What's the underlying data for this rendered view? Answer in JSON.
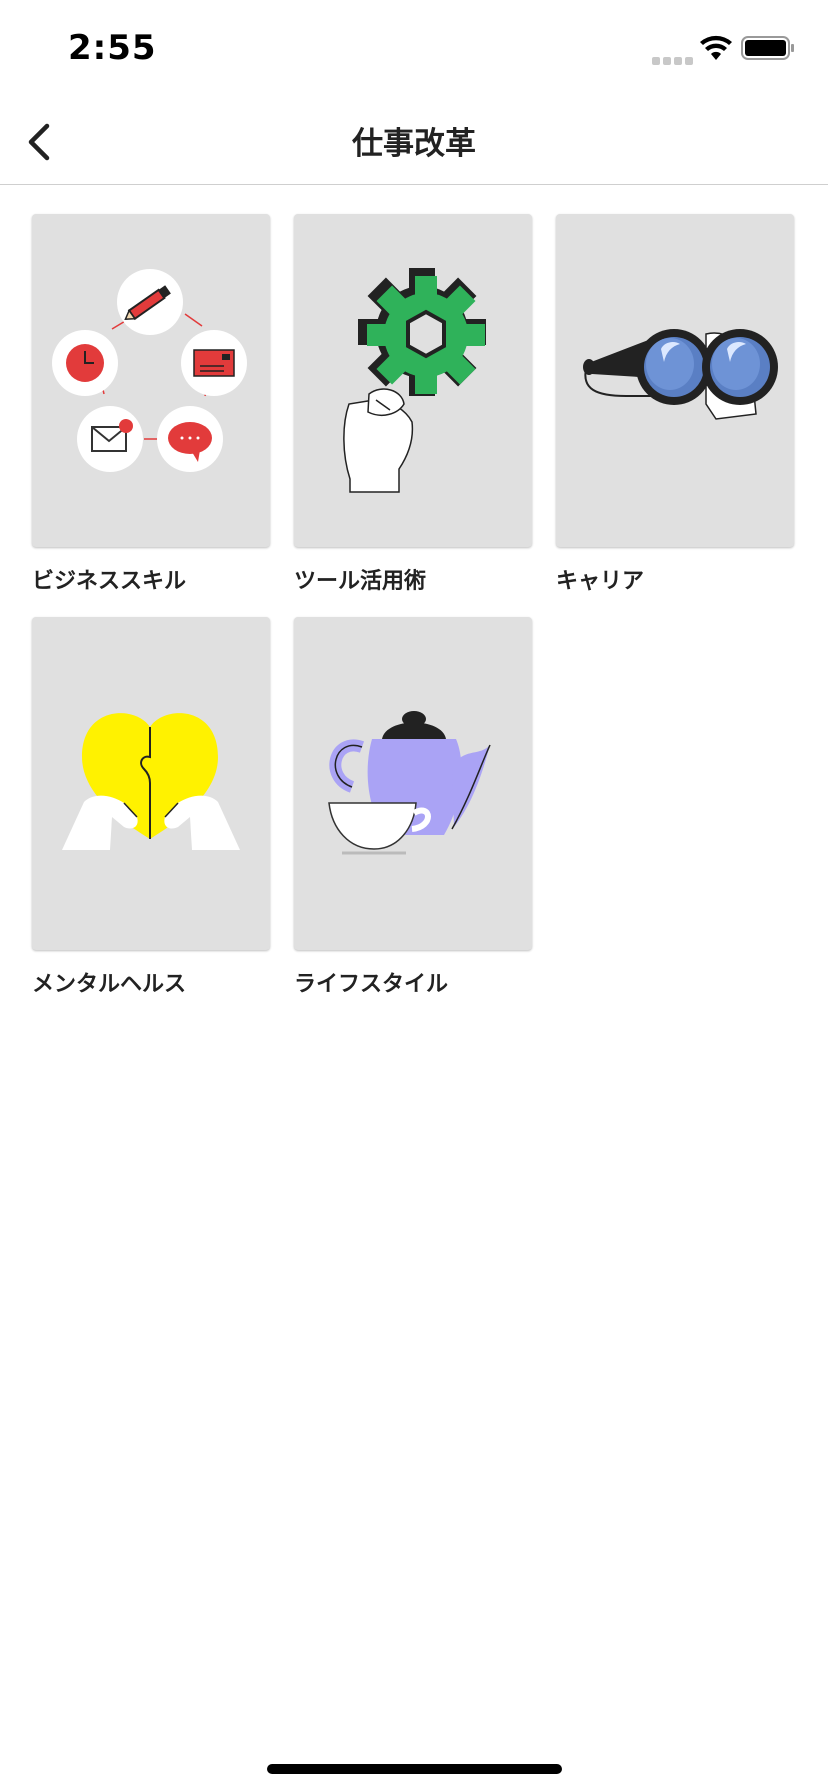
{
  "status_bar": {
    "time": "2:55"
  },
  "nav": {
    "title": "仕事改革"
  },
  "categories": [
    {
      "label": "ビジネススキル"
    },
    {
      "label": "ツール活用術"
    },
    {
      "label": "キャリア"
    },
    {
      "label": "メンタルヘルス"
    },
    {
      "label": "ライフスタイル"
    }
  ]
}
